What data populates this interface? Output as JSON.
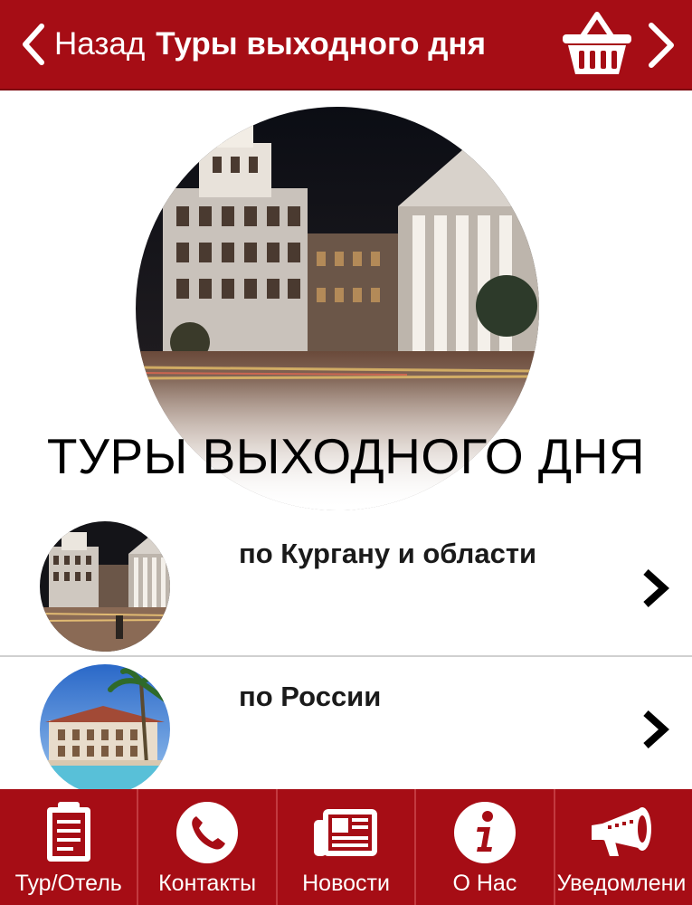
{
  "header": {
    "back_label": "Назад",
    "title": "Туры выходного дня",
    "background_color": "#a60d15",
    "icons": [
      "chevron-left-icon",
      "basket-icon",
      "chevron-right-icon"
    ]
  },
  "hero": {
    "title": "ТУРЫ ВЫХОДНОГО ДНЯ",
    "image": "night-city-square-photo"
  },
  "list": {
    "items": [
      {
        "label": "по Кургану и области",
        "image": "kurgan-night-city-photo",
        "icon": "chevron-right-icon"
      },
      {
        "label": "по России",
        "image": "resort-hotel-palms-photo",
        "icon": "chevron-right-icon"
      }
    ]
  },
  "tabbar": {
    "background_color": "#a60d15",
    "tabs": [
      {
        "label": "Тур/Отель",
        "icon": "clipboard-icon"
      },
      {
        "label": "Контакты",
        "icon": "phone-icon"
      },
      {
        "label": "Новости",
        "icon": "newspaper-icon"
      },
      {
        "label": "О Нас",
        "icon": "info-icon"
      },
      {
        "label": "Уведомлени",
        "icon": "megaphone-icon"
      }
    ]
  }
}
